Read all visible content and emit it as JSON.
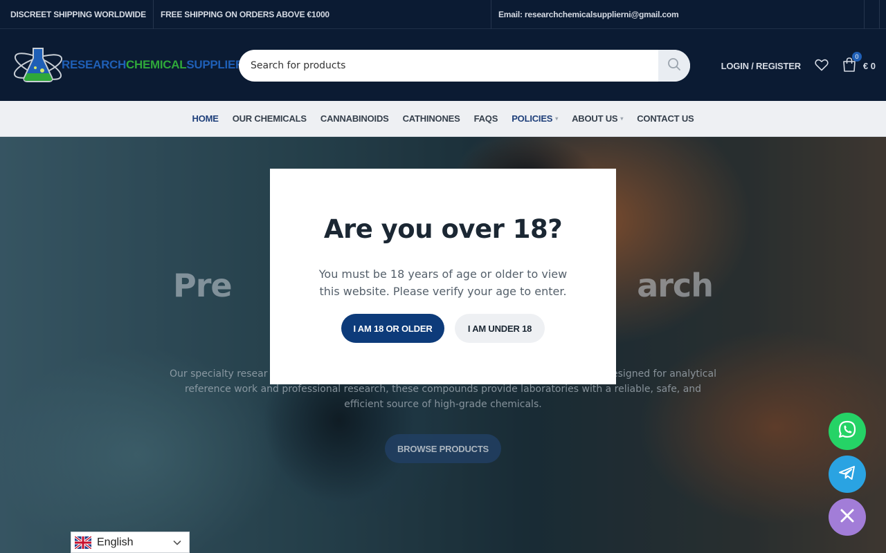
{
  "topbar": {
    "shipping": "DISCREET SHIPPING WORLDWIDE",
    "free_shipping": "FREE SHIPPING ON ORDERS ABOVE €1000",
    "email": "Email: researchchemicalsupplierni@gmail.com"
  },
  "logo": {
    "part1": "RESEARCH",
    "part2": "CHEMICAL",
    "part3": "SUPPLIER"
  },
  "search": {
    "placeholder": "Search for products",
    "icon": "search-icon"
  },
  "header": {
    "login_label": "LOGIN / REGISTER",
    "cart_count": "0",
    "cart_total": "€ 0"
  },
  "nav": {
    "items": [
      {
        "label": "HOME"
      },
      {
        "label": "OUR CHEMICALS"
      },
      {
        "label": "CANNABINOIDS"
      },
      {
        "label": "CATHINONES"
      },
      {
        "label": "FAQS"
      },
      {
        "label": "POLICIES"
      },
      {
        "label": "ABOUT US"
      },
      {
        "label": "CONTACT US"
      }
    ]
  },
  "hero": {
    "title": "Pre                                       arch",
    "desc": "Our specialty resear                                                                                           onsistency. Designed for analytical reference work and professional research, these compounds provide laboratories with a reliable, safe, and efficient source of high-grade chemicals.",
    "button_label": "BROWSE PRODUCTS"
  },
  "modal": {
    "title": "Are you over 18?",
    "text": "You must be 18 years of age or older to view this website. Please verify your age to enter.",
    "yes_label": "I AM 18 OR OLDER",
    "no_label": "I AM UNDER 18"
  },
  "floating": {
    "whatsapp_icon": "whatsapp-icon",
    "telegram_icon": "telegram-icon",
    "close_icon": "close-icon"
  },
  "language": {
    "selected": "English"
  },
  "colors": {
    "header_bg": "#0b1b33",
    "primary": "#0d3b7a",
    "whatsapp": "#25d366",
    "telegram": "#2aa3e2",
    "close": "#a27dd8"
  }
}
